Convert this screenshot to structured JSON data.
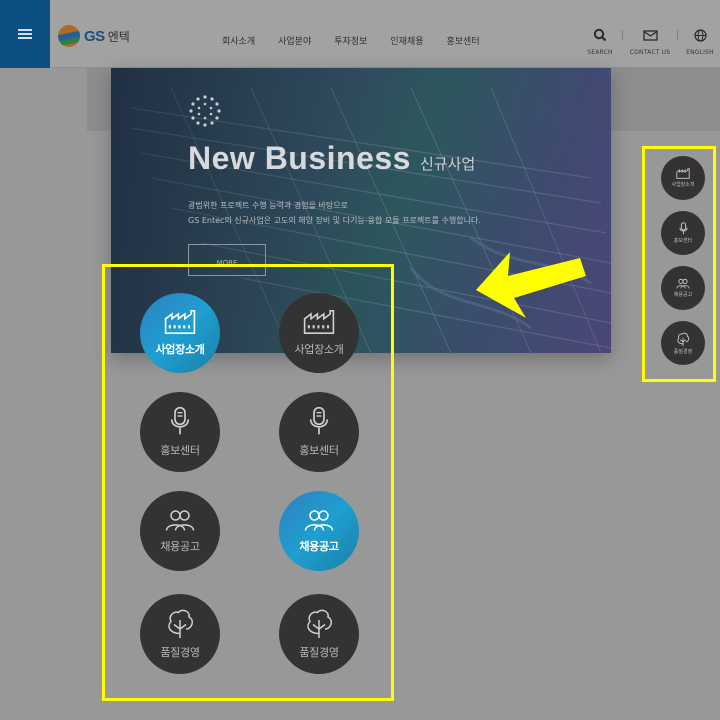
{
  "header": {
    "logo_gs": "GS",
    "logo_kr": "엔텍",
    "nav": [
      "회사소개",
      "사업분야",
      "투자정보",
      "인재채용",
      "홍보센터"
    ],
    "utilities": [
      {
        "icon": "search-icon",
        "label": "SEARCH"
      },
      {
        "icon": "mail-icon",
        "label": "CONTACT US"
      },
      {
        "icon": "globe-icon",
        "label": "ENGLISH"
      }
    ]
  },
  "hero": {
    "title_en": "New Business",
    "title_kr": "신규사업",
    "desc_line1": "광범위한 프로젝트 수행 능력과 경험을 바탕으로",
    "desc_line2": "GS Entec의 신규사업은 고도의 해양 장비 및 다기능-융합 모듈 프로젝트를 수행합니다.",
    "more": "MORE"
  },
  "quick_rail": {
    "items": [
      {
        "icon": "factory-icon",
        "label": "사업장소개"
      },
      {
        "icon": "microphone-icon",
        "label": "홍보센터"
      },
      {
        "icon": "people-icon",
        "label": "채용공고"
      },
      {
        "icon": "tree-icon",
        "label": "품질경영"
      }
    ]
  },
  "states": {
    "rows": [
      {
        "icon": "factory-icon",
        "label": "사업장소개",
        "left_active": true,
        "right_active": false
      },
      {
        "icon": "microphone-icon",
        "label": "홍보센터",
        "left_active": false,
        "right_active": false
      },
      {
        "icon": "people-icon",
        "label": "채용공고",
        "left_active": false,
        "right_active": true
      },
      {
        "icon": "tree-icon",
        "label": "품질경영",
        "left_active": false,
        "right_active": false
      }
    ]
  },
  "colors": {
    "brand_blue": "#0c4f83",
    "active_gradient_start": "#2e7fc0",
    "active_gradient_end": "#1a7fa8",
    "highlight_yellow": "#ffff00",
    "button_dark": "#333333"
  }
}
